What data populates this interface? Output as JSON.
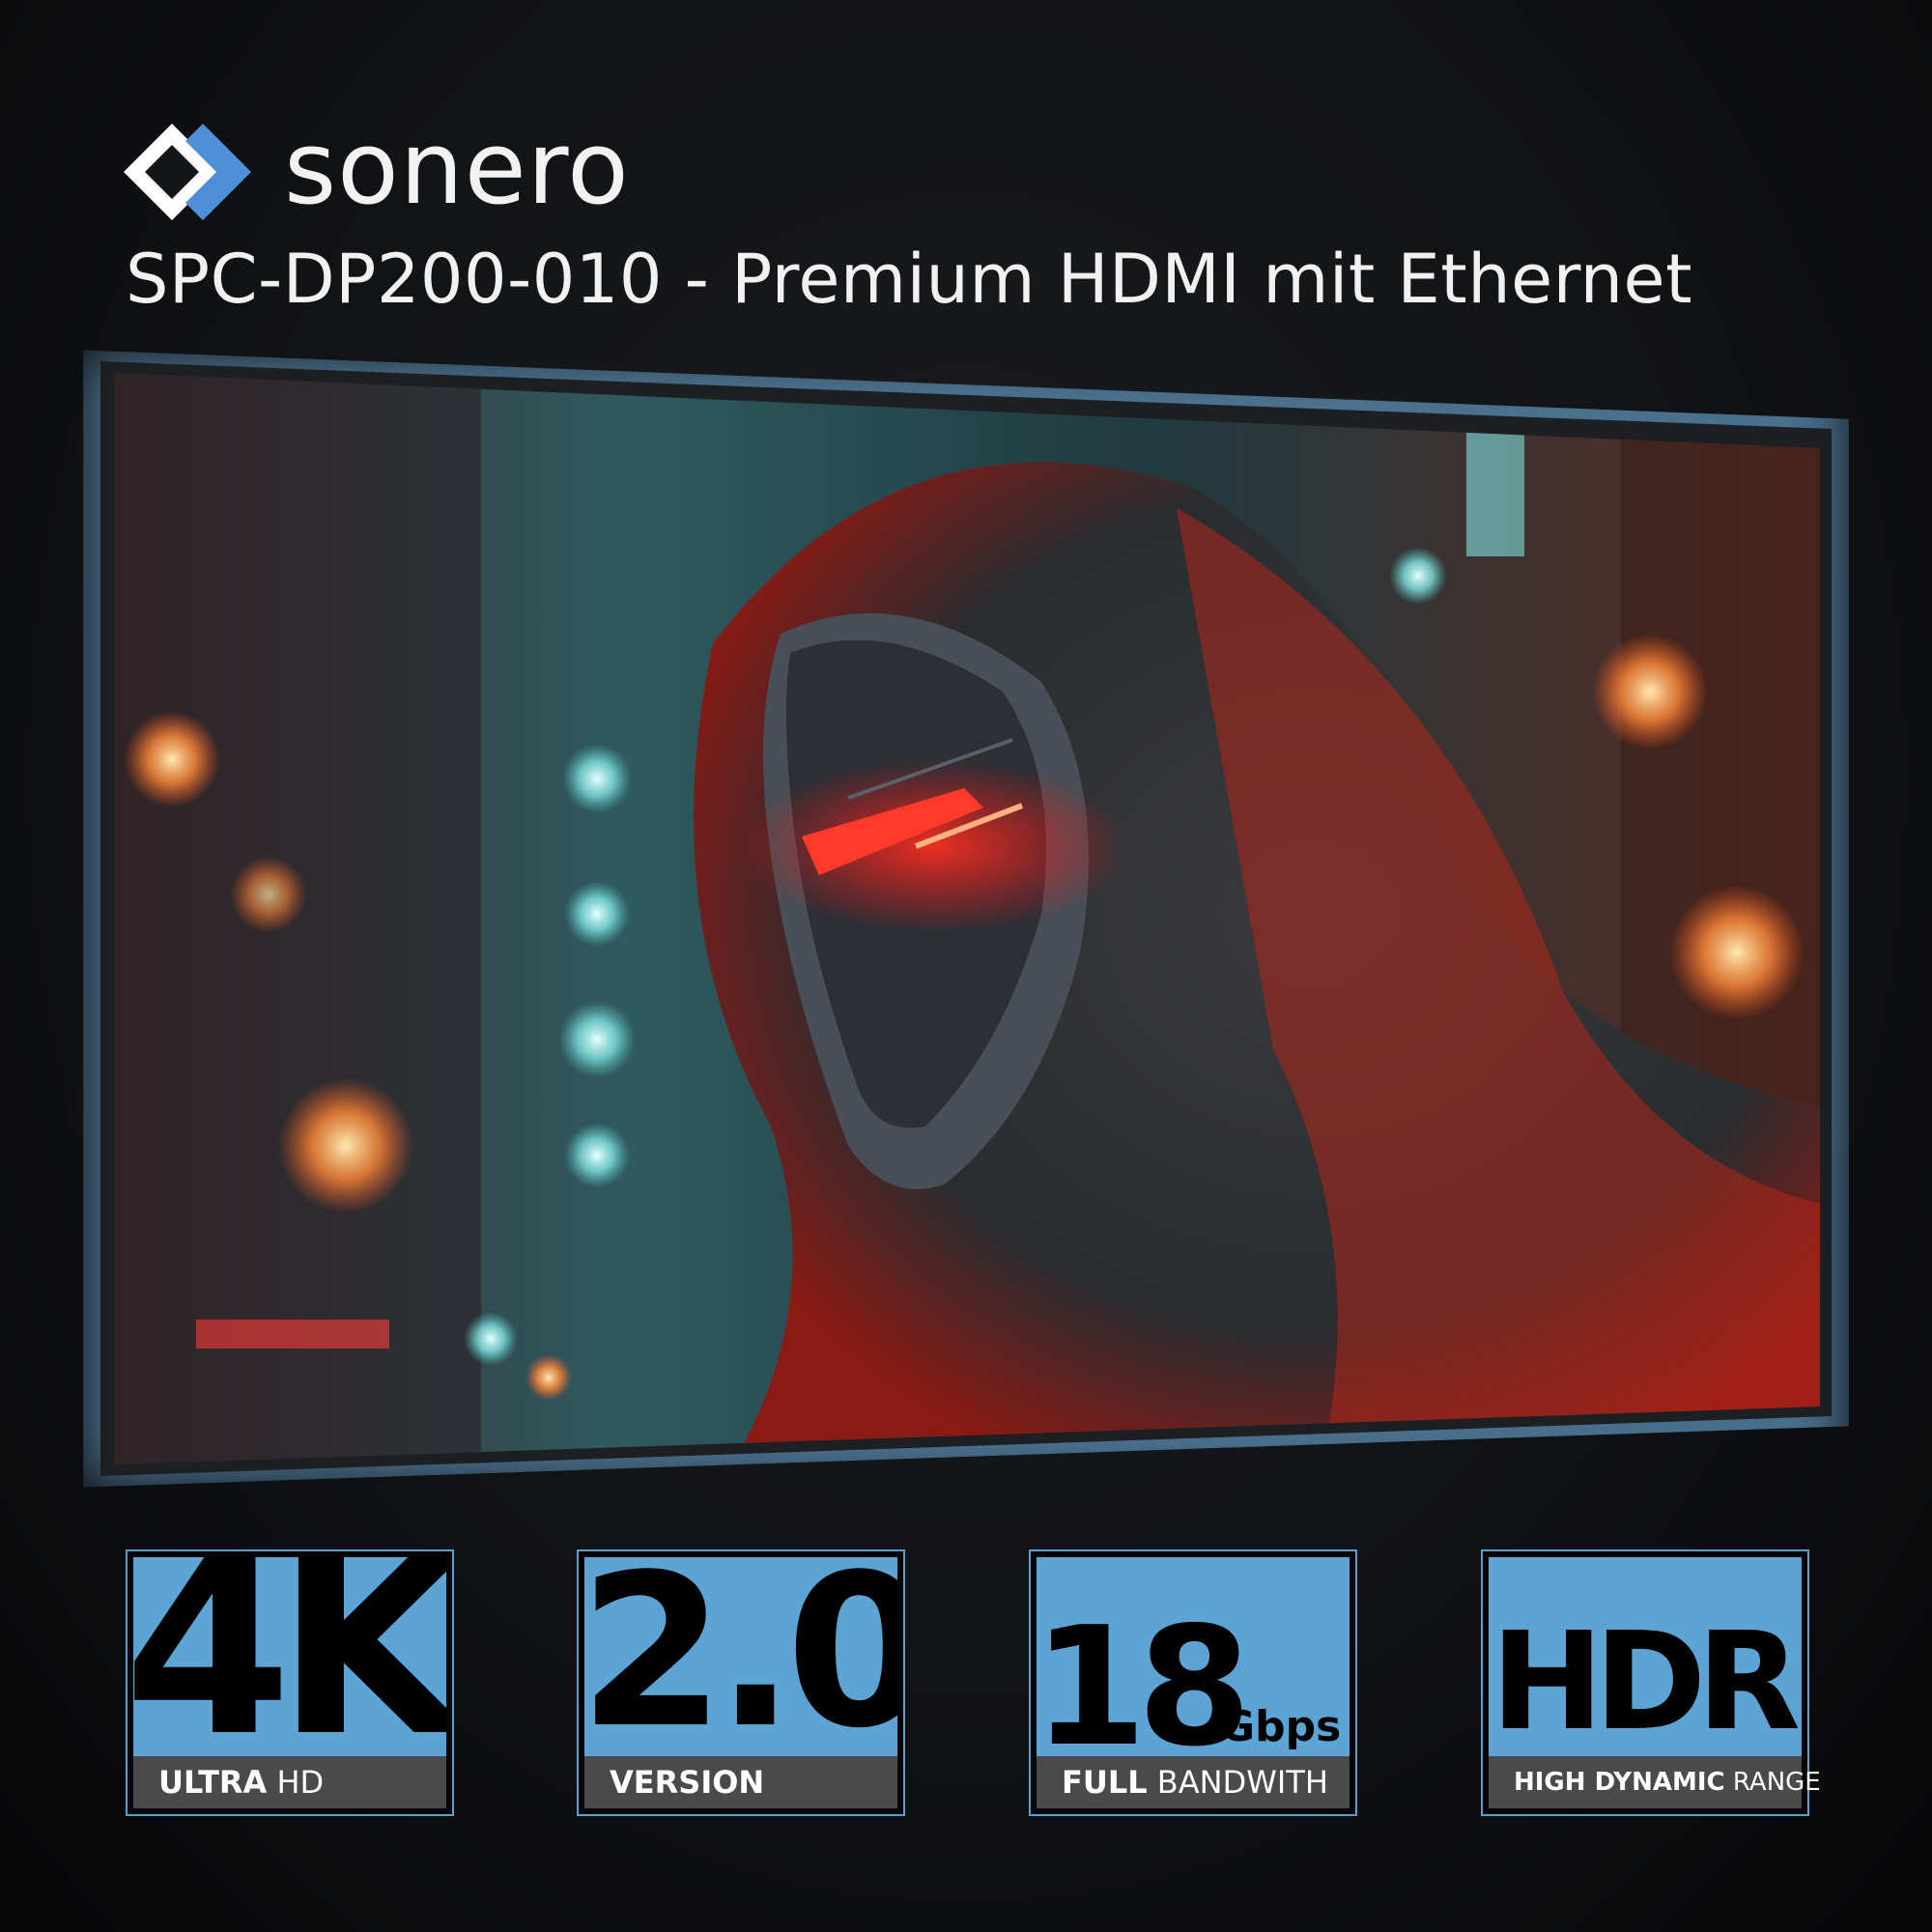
{
  "brand": {
    "name": "sonero",
    "logo_colors": {
      "white": "#ffffff",
      "blue": "#4e8fd8"
    }
  },
  "product": {
    "title": "SPC-DP200-010 - Premium HDMI mit Ethernet"
  },
  "screen": {
    "image_icon": "hooded-cyborg-image",
    "ambient_light_color": "#8cc8f0"
  },
  "badges": [
    {
      "big": "4K",
      "label_bold": "ULTRA",
      "label_light": " HD"
    },
    {
      "big": "2.0",
      "label_bold": "VERSION",
      "label_light": ""
    },
    {
      "big": "18",
      "unit": "Gbps",
      "label_bold": "FULL",
      "label_light": " BANDWITH"
    },
    {
      "big": "HDR",
      "label_bold": "HIGH DYNAMIC",
      "label_light": " RANGE"
    }
  ],
  "colors": {
    "badge_blue": "#5ba4d4",
    "badge_label_bg": "#4a4a4a"
  }
}
